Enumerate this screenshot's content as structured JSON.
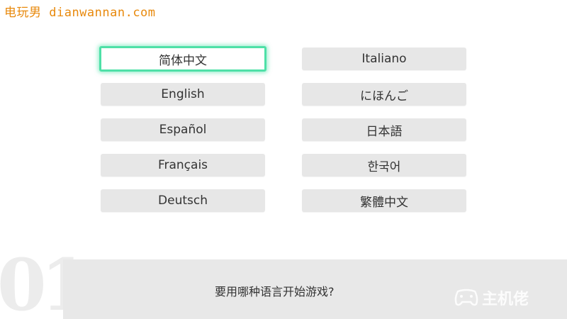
{
  "watermark": {
    "top_text": "电玩男 dianwannan.com",
    "logo_text": "主机佬"
  },
  "languages": {
    "left": [
      {
        "label": "简体中文",
        "selected": true
      },
      {
        "label": "English",
        "selected": false
      },
      {
        "label": "Español",
        "selected": false
      },
      {
        "label": "Français",
        "selected": false
      },
      {
        "label": "Deutsch",
        "selected": false
      }
    ],
    "right": [
      {
        "label": "Italiano",
        "selected": false
      },
      {
        "label": "にほんご",
        "selected": false
      },
      {
        "label": "日本語",
        "selected": false
      },
      {
        "label": "한국어",
        "selected": false
      },
      {
        "label": "繁體中文",
        "selected": false
      }
    ]
  },
  "step": {
    "number": "01",
    "prompt": "要用哪种语言开始游戏?"
  },
  "colors": {
    "selection_glow": "#4ee0a7",
    "button_bg": "#e7e7e7",
    "watermark_orange": "#e8890c"
  }
}
